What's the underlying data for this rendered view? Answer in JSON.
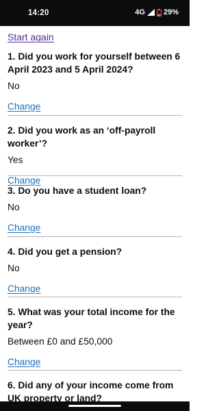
{
  "status_bar": {
    "time": "14:20",
    "network": "4G",
    "battery": "29%",
    "battery_color": "#ff5a4f"
  },
  "start_again": "Start again",
  "questions": [
    {
      "question": "1. Did you work for yourself between 6 April 2023 and 5 April 2024?",
      "answer": "No",
      "change": "Change"
    },
    {
      "question": "2. Did you work as an ‘off-payroll worker’?",
      "answer": "Yes",
      "change": "Change"
    },
    {
      "question": "3. Do you have a student loan?",
      "answer": "No",
      "change": "Change"
    },
    {
      "question": "4. Did you get a pension?",
      "answer": "No",
      "change": "Change"
    },
    {
      "question": "5. What was your total income for the year?",
      "answer": "Between £0 and £50,000",
      "change": "Change"
    },
    {
      "question": "6. Did any of your income come from UK property or land?"
    }
  ],
  "colors": {
    "link": "#1d70b8",
    "visited_link": "#4c2c92",
    "text": "#0b0c0c",
    "divider": "#b1b4b6"
  }
}
